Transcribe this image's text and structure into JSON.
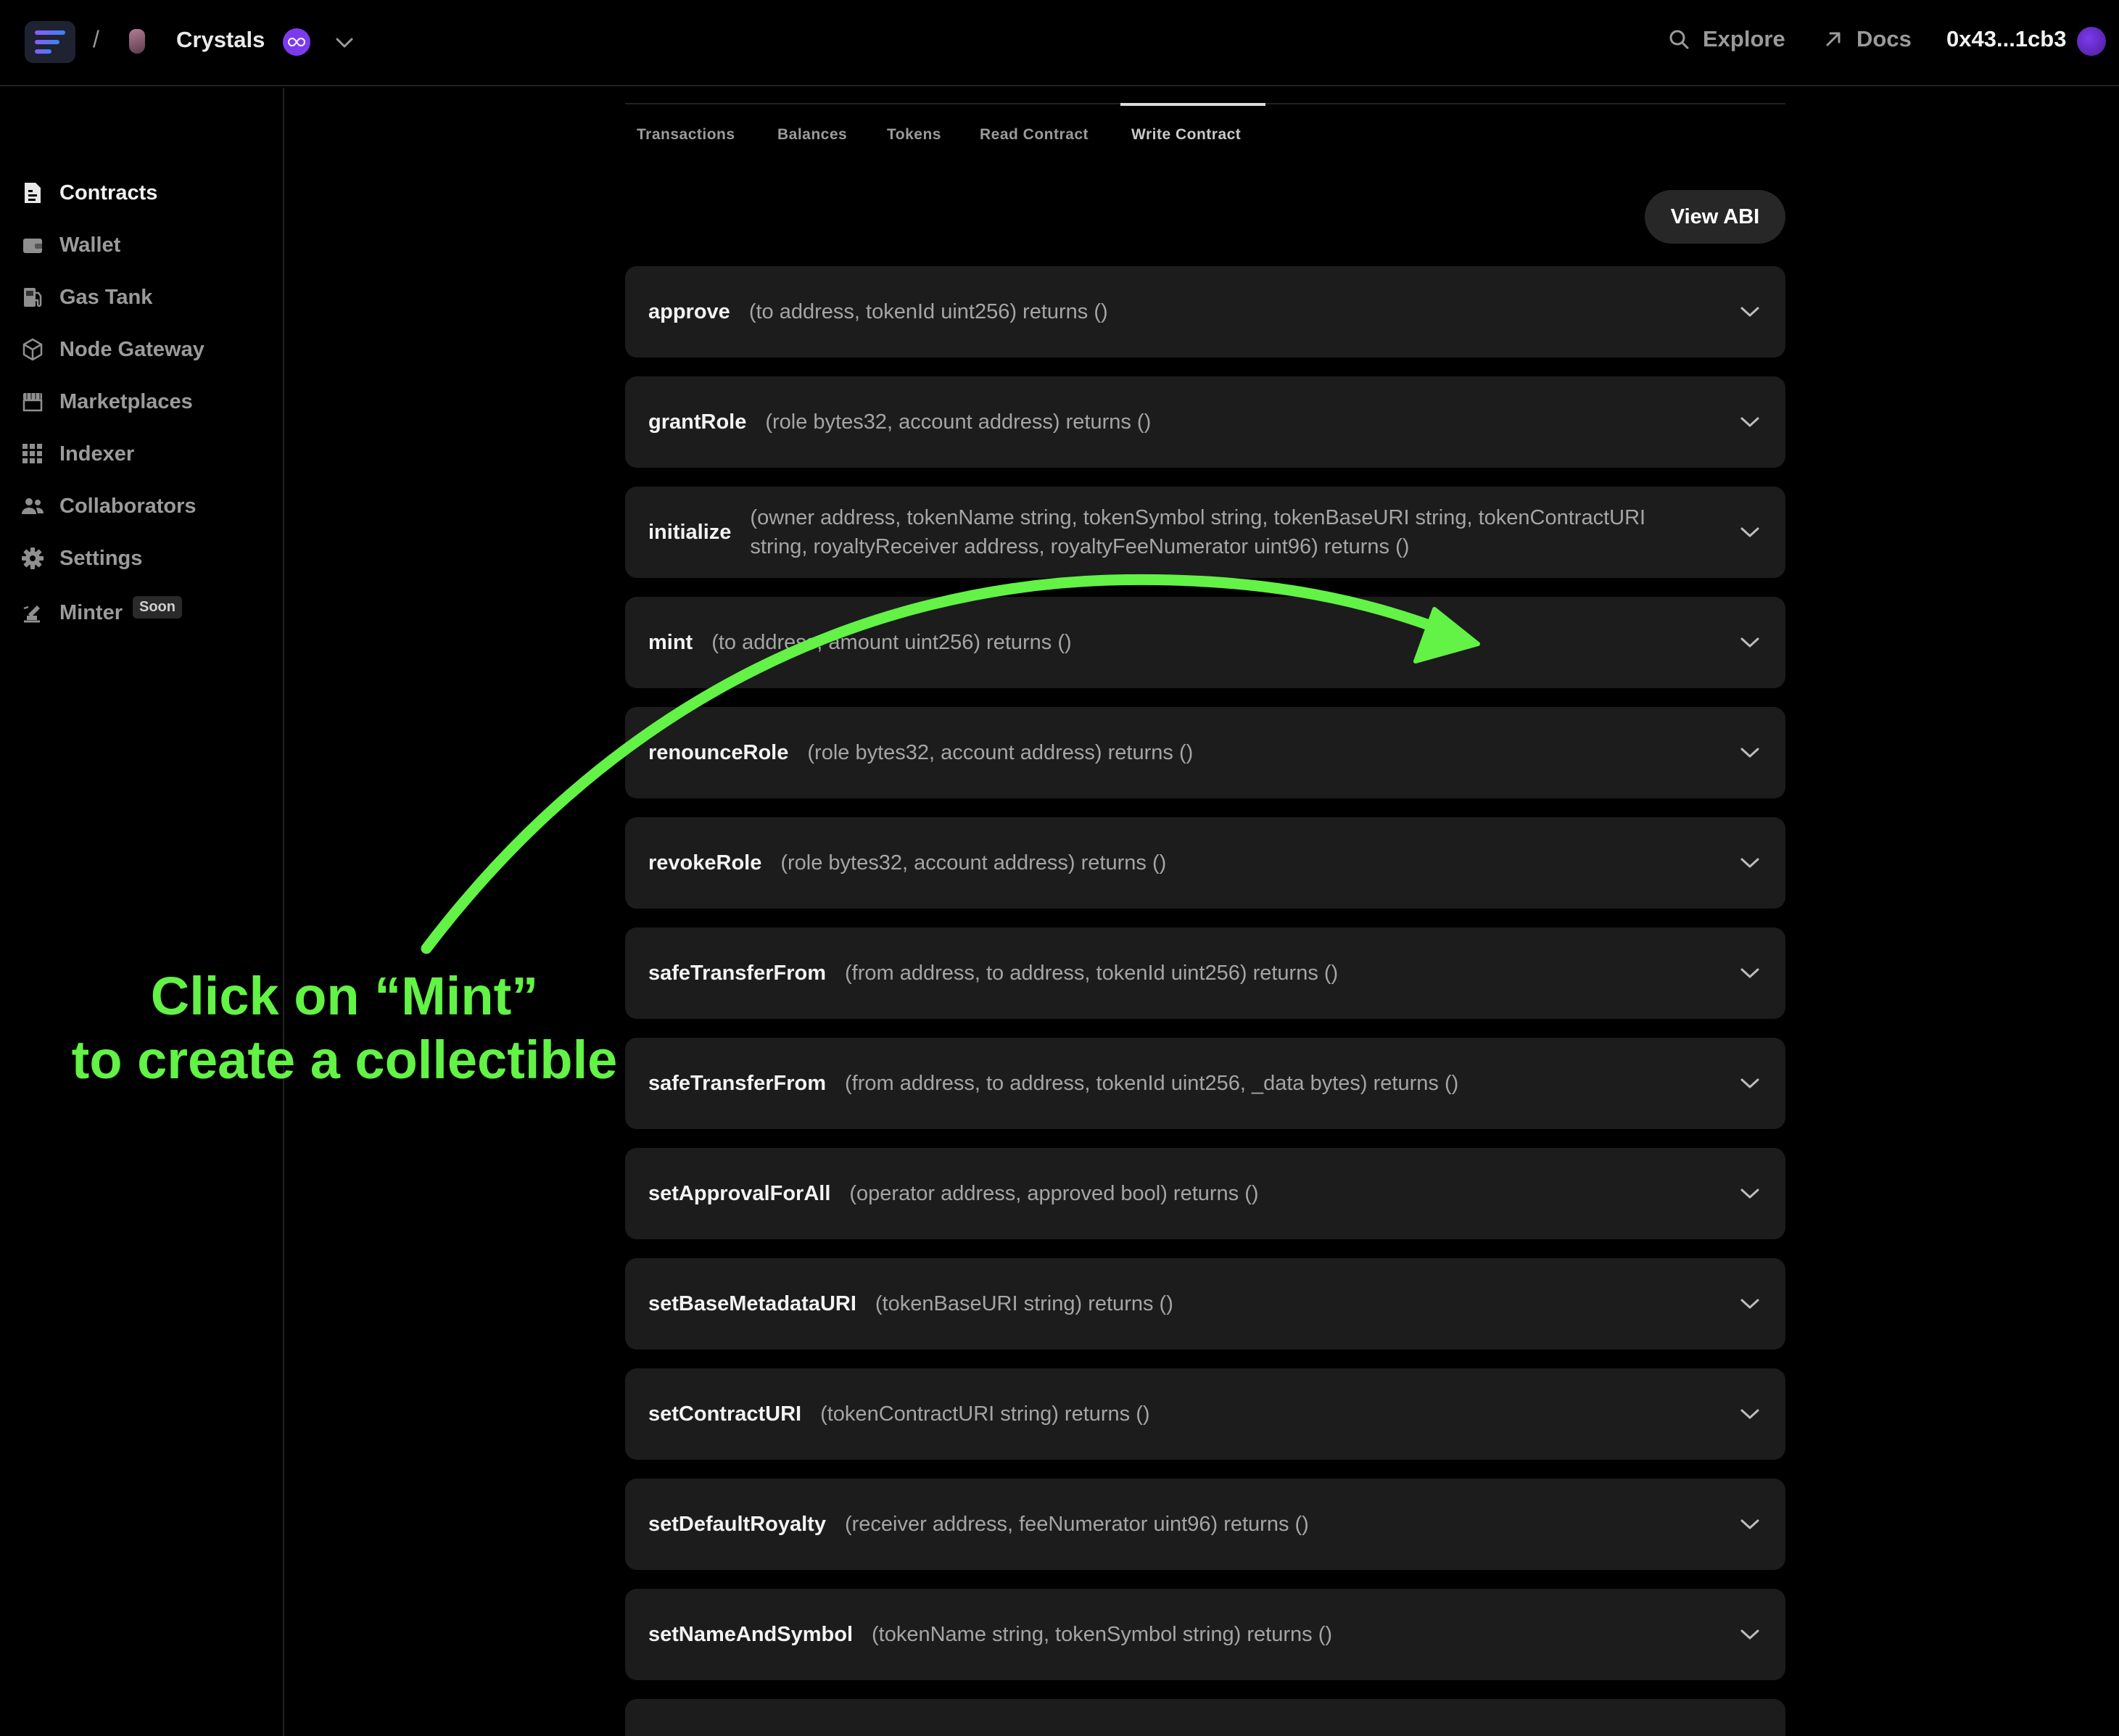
{
  "header": {
    "breadcrumb_sep": "/",
    "project_name": "Crystals",
    "explore_label": "Explore",
    "docs_label": "Docs",
    "wallet_address": "0x43...1cb3"
  },
  "sidebar": {
    "items": [
      {
        "label": "Contracts",
        "icon": "contract-icon",
        "active": true
      },
      {
        "label": "Wallet",
        "icon": "wallet-icon"
      },
      {
        "label": "Gas Tank",
        "icon": "gas-pump-icon"
      },
      {
        "label": "Node Gateway",
        "icon": "cube-icon"
      },
      {
        "label": "Marketplaces",
        "icon": "storefront-icon"
      },
      {
        "label": "Indexer",
        "icon": "grid-icon"
      },
      {
        "label": "Collaborators",
        "icon": "users-icon"
      },
      {
        "label": "Settings",
        "icon": "gear-icon"
      },
      {
        "label": "Minter",
        "icon": "minter-icon",
        "badge": "Soon"
      }
    ]
  },
  "tabs": [
    {
      "label": "Transactions"
    },
    {
      "label": "Balances"
    },
    {
      "label": "Tokens"
    },
    {
      "label": "Read Contract"
    },
    {
      "label": "Write Contract",
      "active": true
    }
  ],
  "view_abi_label": "View ABI",
  "functions": [
    {
      "name": "approve",
      "signature": "(to address, tokenId uint256) returns ()"
    },
    {
      "name": "grantRole",
      "signature": "(role bytes32, account address) returns ()"
    },
    {
      "name": "initialize",
      "signature": "(owner address, tokenName string, tokenSymbol string, tokenBaseURI string, tokenContractURI string, royaltyReceiver address, royaltyFeeNumerator uint96) returns ()"
    },
    {
      "name": "mint",
      "signature": "(to address, amount uint256) returns ()"
    },
    {
      "name": "renounceRole",
      "signature": "(role bytes32, account address) returns ()"
    },
    {
      "name": "revokeRole",
      "signature": "(role bytes32, account address) returns ()"
    },
    {
      "name": "safeTransferFrom",
      "signature": "(from address, to address, tokenId uint256) returns ()"
    },
    {
      "name": "safeTransferFrom",
      "signature": "(from address, to address, tokenId uint256, _data bytes) returns ()"
    },
    {
      "name": "setApprovalForAll",
      "signature": "(operator address, approved bool) returns ()"
    },
    {
      "name": "setBaseMetadataURI",
      "signature": "(tokenBaseURI string) returns ()"
    },
    {
      "name": "setContractURI",
      "signature": "(tokenContractURI string) returns ()"
    },
    {
      "name": "setDefaultRoyalty",
      "signature": "(receiver address, feeNumerator uint96) returns ()"
    },
    {
      "name": "setNameAndSymbol",
      "signature": "(tokenName string, tokenSymbol string) returns ()"
    },
    {
      "name": "",
      "signature": ""
    }
  ],
  "annotation": {
    "line1": "Click on “Mint”",
    "line2": "to create a collectible",
    "color": "#63f246"
  },
  "colors": {
    "background": "#000000",
    "card": "#1c1c1c",
    "accent_purple": "#7c3aed"
  }
}
